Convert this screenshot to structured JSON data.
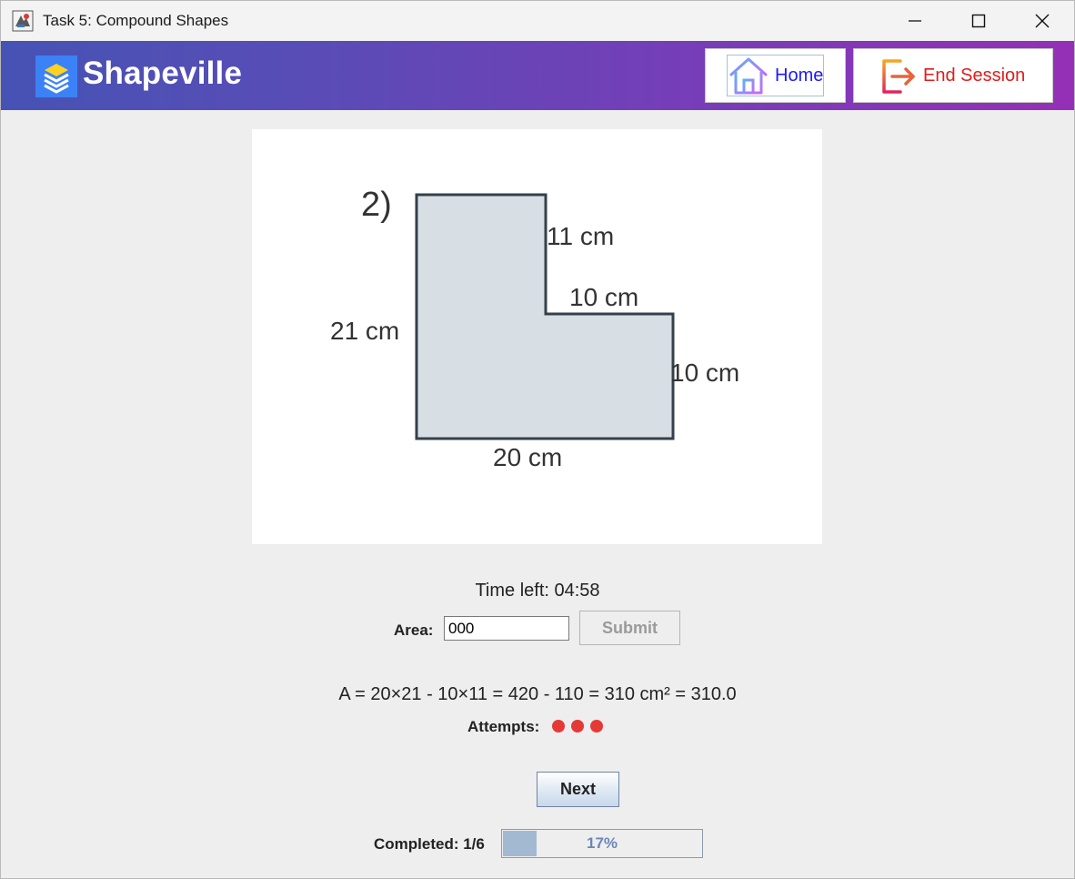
{
  "window": {
    "title": "Task 5: Compound Shapes",
    "icon": "app-icon",
    "controls": [
      "minimize-icon",
      "maximize-icon",
      "close-icon"
    ]
  },
  "header": {
    "brand": "Shapeville",
    "brand_icon": "layers-icon",
    "gradient_colors": [
      "#4653b4",
      "#9530b6"
    ],
    "home_button": {
      "label": "Home",
      "icon": "home-icon"
    },
    "end_button": {
      "label": "End Session",
      "icon": "exit-icon"
    }
  },
  "figure": {
    "number": "2)",
    "labels": {
      "top": "11 cm",
      "middle": "10 cm",
      "left": "21 cm",
      "right": "10 cm",
      "bottom": "20 cm"
    },
    "fill_color": "#d7dfe5",
    "stroke_color": "#34404a"
  },
  "timer": {
    "text": "Time left: 04:58"
  },
  "answer": {
    "label": "Area:",
    "value": "000",
    "submit_label": "Submit"
  },
  "solution": {
    "text": "A = 20×21 - 10×11 = 420 - 110 = 310 cm² = 310.0"
  },
  "attempts": {
    "label": "Attempts:",
    "count": 3,
    "color": "#e53935"
  },
  "next": {
    "label": "Next"
  },
  "progress": {
    "label": "Completed: 1/6",
    "percent": 17,
    "percent_text": "17%"
  }
}
